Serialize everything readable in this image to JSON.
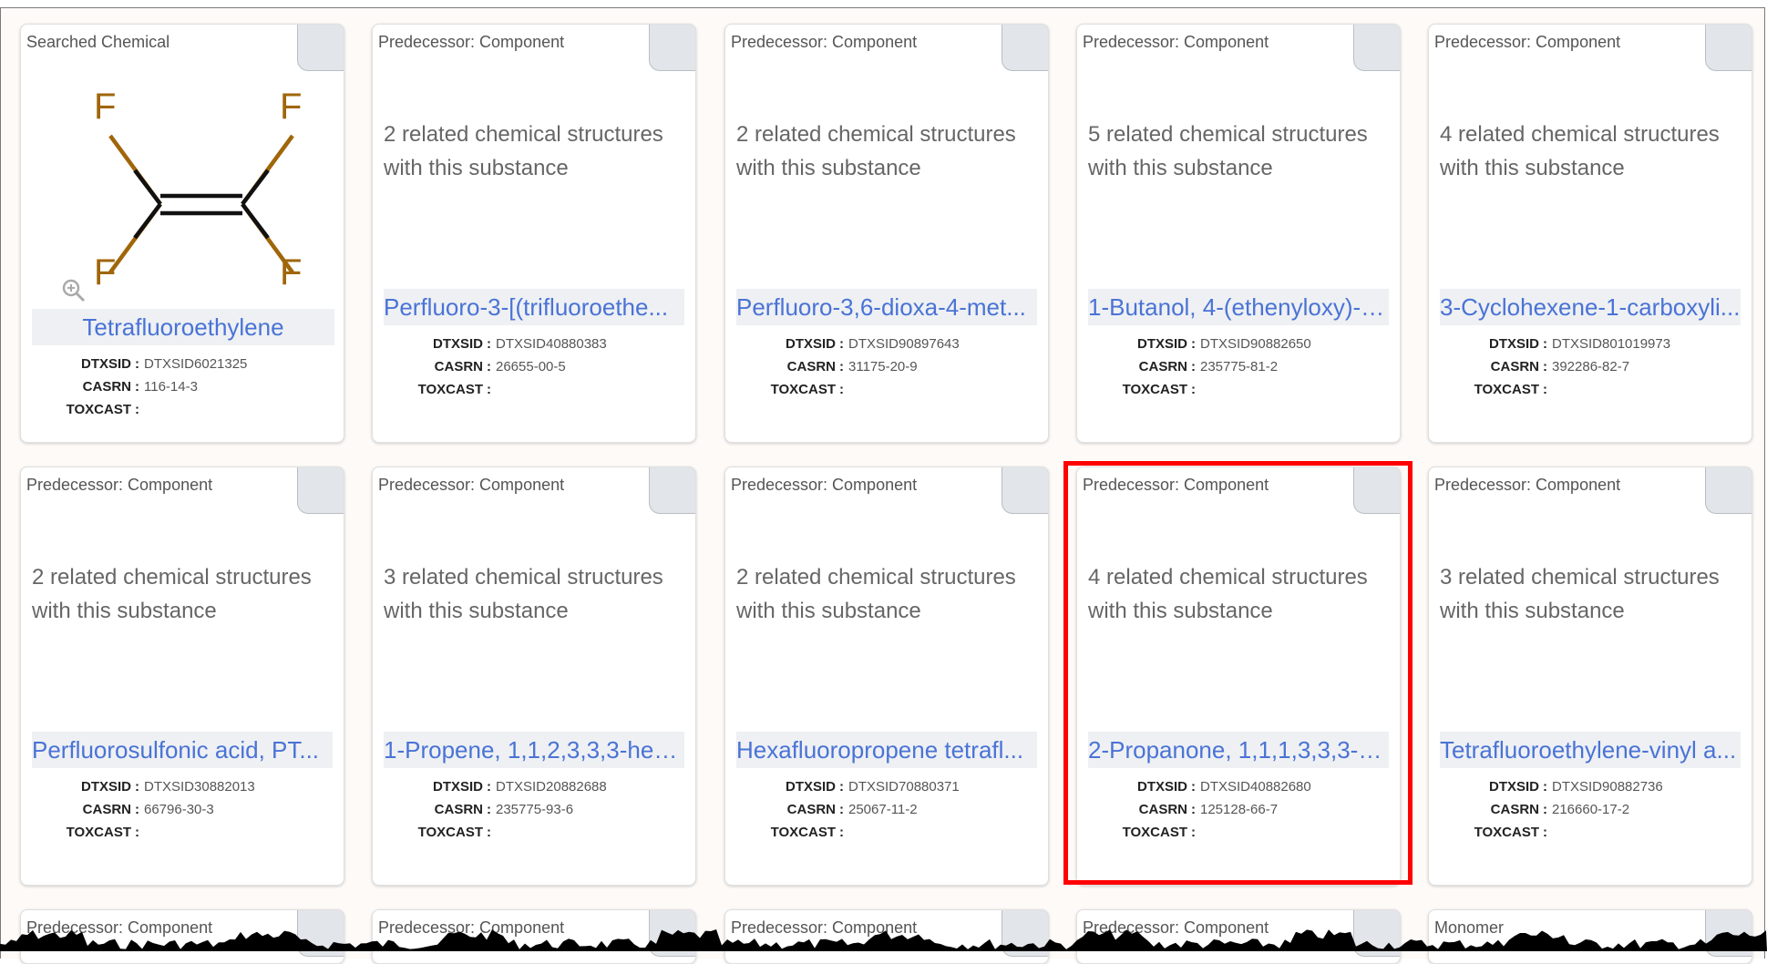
{
  "searched_card": {
    "type_label": "Searched Chemical",
    "name": "Tetrafluoroethylene",
    "atoms": [
      "F",
      "F",
      "F",
      "F"
    ],
    "props": [
      {
        "key": "DTXSID",
        "value": "DTXSID6021325"
      },
      {
        "key": "CASRN",
        "value": "116-14-3"
      },
      {
        "key": "TOXCAST",
        "value": ""
      }
    ]
  },
  "cards": [
    {
      "type_label": "Predecessor: Component",
      "related": "2 related chemical structures with this substance",
      "name": "Perfluoro-3-[(trifluoroethe...",
      "dtxsid": "DTXSID40880383",
      "casrn": "26655-00-5",
      "toxcast": ""
    },
    {
      "type_label": "Predecessor: Component",
      "related": "2 related chemical structures with this substance",
      "name": "Perfluoro-3,6-dioxa-4-met...",
      "dtxsid": "DTXSID90897643",
      "casrn": "31175-20-9",
      "toxcast": ""
    },
    {
      "type_label": "Predecessor: Component",
      "related": "5 related chemical structures with this substance",
      "name": "1-Butanol, 4-(ethenyloxy)-, ...",
      "dtxsid": "DTXSID90882650",
      "casrn": "235775-81-2",
      "toxcast": ""
    },
    {
      "type_label": "Predecessor: Component",
      "related": "4 related chemical structures with this substance",
      "name": "3-Cyclohexene-1-carboxyli...",
      "dtxsid": "DTXSID801019973",
      "casrn": "392286-82-7",
      "toxcast": ""
    },
    {
      "type_label": "Predecessor: Component",
      "related": "2 related chemical structures with this substance",
      "name": "Perfluorosulfonic acid, PT...",
      "dtxsid": "DTXSID30882013",
      "casrn": "66796-30-3",
      "toxcast": ""
    },
    {
      "type_label": "Predecessor: Component",
      "related": "3 related chemical structures with this substance",
      "name": "1-Propene, 1,1,2,3,3,3-hex...",
      "dtxsid": "DTXSID20882688",
      "casrn": "235775-93-6",
      "toxcast": ""
    },
    {
      "type_label": "Predecessor: Component",
      "related": "2 related chemical structures with this substance",
      "name": "Hexafluoropropene tetrafl...",
      "dtxsid": "DTXSID70880371",
      "casrn": "25067-11-2",
      "toxcast": ""
    },
    {
      "type_label": "Predecessor: Component",
      "related": "4 related chemical structures with this substance",
      "name": "2-Propanone, 1,1,1,3,3,3-h...",
      "dtxsid": "DTXSID40882680",
      "casrn": "125128-66-7",
      "toxcast": ""
    },
    {
      "type_label": "Predecessor: Component",
      "related": "3 related chemical structures with this substance",
      "name": "Tetrafluoroethylene-vinyl a...",
      "dtxsid": "DTXSID90882736",
      "casrn": "216660-17-2",
      "toxcast": ""
    }
  ],
  "bottom_row": [
    {
      "type_label": "Predecessor: Component"
    },
    {
      "type_label": "Predecessor: Component"
    },
    {
      "type_label": "Predecessor: Component"
    },
    {
      "type_label": "Predecessor: Component"
    },
    {
      "type_label": "Monomer"
    }
  ],
  "prop_labels": {
    "dtxsid": "DTXSID",
    "casrn": "CASRN",
    "toxcast": "TOXCAST"
  },
  "colors": {
    "link": "#4a73d6",
    "highlight": "#ff0000",
    "fluorine": "#a0660a",
    "bond": "#111111"
  }
}
